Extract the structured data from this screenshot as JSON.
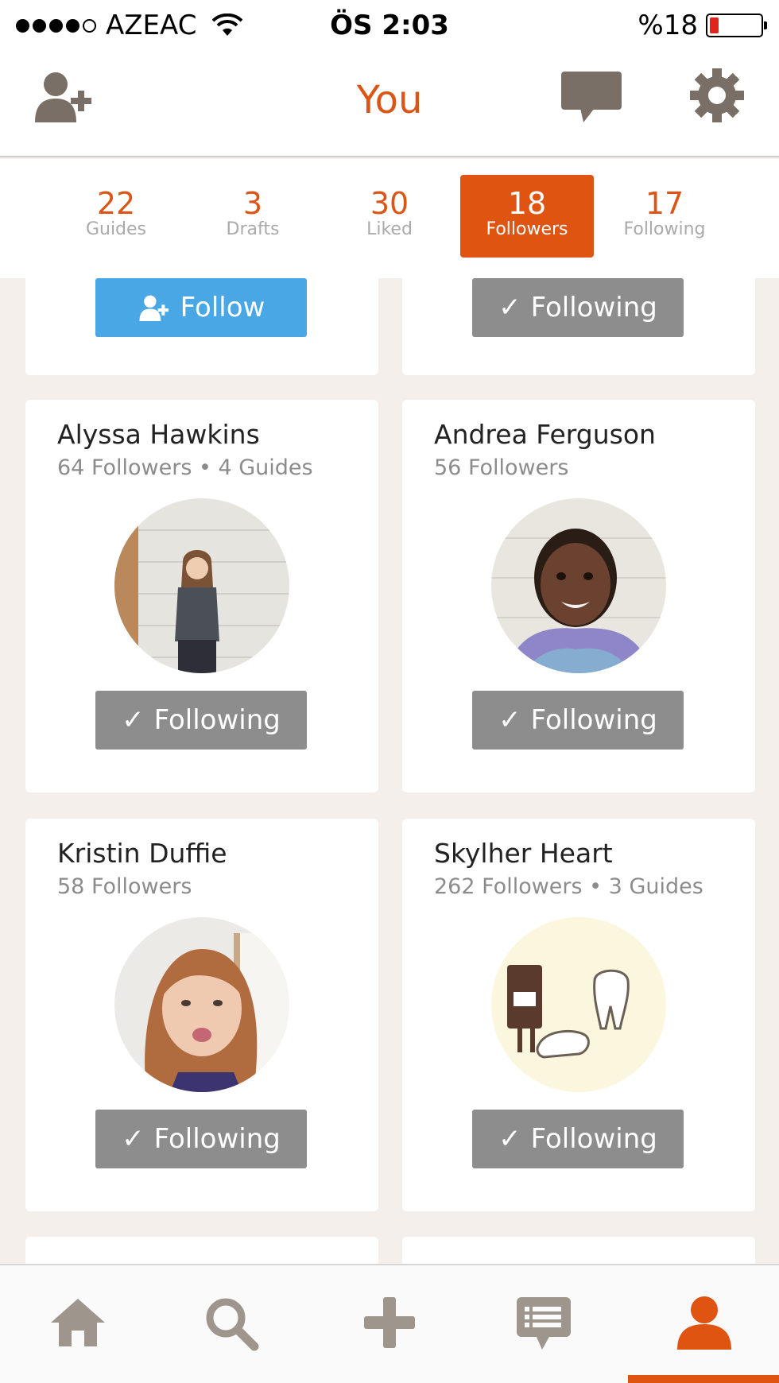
{
  "status_bar": {
    "carrier": "AZEAC",
    "time": "ÖS 2:03",
    "battery": "%18",
    "battery_level": 0.18
  },
  "nav": {
    "title": "You",
    "left_icon": "add-user-icon",
    "right_icons": [
      "chat-icon",
      "gear-icon"
    ]
  },
  "stats": [
    {
      "value": "22",
      "label": "Guides"
    },
    {
      "value": "3",
      "label": "Drafts"
    },
    {
      "value": "30",
      "label": "Liked"
    },
    {
      "value": "18",
      "label": "Followers",
      "active": true
    },
    {
      "value": "17",
      "label": "Following"
    }
  ],
  "top_partial_cards": {
    "left_button": "Follow",
    "right_button": "Following"
  },
  "followers": [
    {
      "name": "Alyssa Hawkins",
      "meta": "64 Followers • 4 Guides",
      "button": "Following"
    },
    {
      "name": "Andrea Ferguson",
      "meta": "56 Followers",
      "button": "Following"
    },
    {
      "name": "Kristin Duffie",
      "meta": "58 Followers",
      "button": "Following"
    },
    {
      "name": "Skylher Heart",
      "meta": "262 Followers • 3 Guides",
      "button": "Following"
    }
  ],
  "tab_bar": {
    "tabs": [
      "home-icon",
      "search-icon",
      "add-icon",
      "messages-icon",
      "profile-icon"
    ],
    "active_tab": "profile-icon"
  },
  "colors": {
    "accent": "#e05412",
    "follow_blue": "#4aa7e6",
    "following_gray": "#8d8d8d",
    "icon_gray": "#7a6f66"
  }
}
